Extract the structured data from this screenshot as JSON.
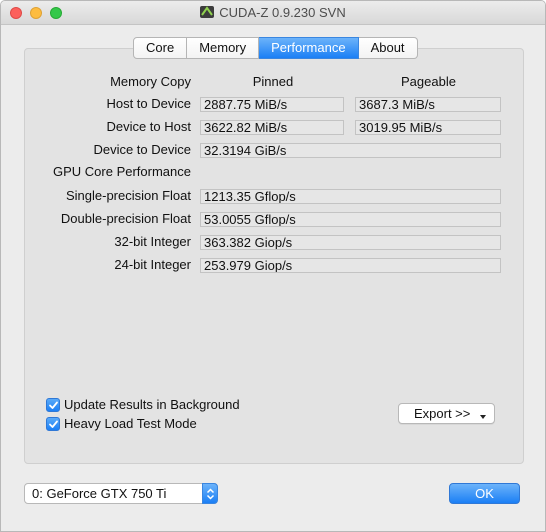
{
  "window": {
    "title": "CUDA-Z 0.9.230 SVN",
    "colors": {
      "accent": "#1b7ff5",
      "close": "#fc605c",
      "minimize": "#fdbc40",
      "maximize": "#34c84a"
    }
  },
  "tabs": [
    {
      "label": "Core"
    },
    {
      "label": "Memory"
    },
    {
      "label": "Performance",
      "active": true
    },
    {
      "label": "About"
    }
  ],
  "performance": {
    "memory_copy_label": "Memory Copy",
    "pinned_header": "Pinned",
    "pageable_header": "Pageable",
    "rows_memory": [
      {
        "label": "Host to Device",
        "pinned": "2887.75 MiB/s",
        "pageable": "3687.3 MiB/s"
      },
      {
        "label": "Device to Host",
        "pinned": "3622.82 MiB/s",
        "pageable": "3019.95 MiB/s"
      },
      {
        "label": "Device to Device",
        "pinned": "32.3194 GiB/s"
      }
    ],
    "gpu_core_label": "GPU Core Performance",
    "rows_core": [
      {
        "label": "Single-precision Float",
        "value": "1213.35 Gflop/s"
      },
      {
        "label": "Double-precision Float",
        "value": "53.0055 Gflop/s"
      },
      {
        "label": "32-bit Integer",
        "value": "363.382 Giop/s"
      },
      {
        "label": "24-bit Integer",
        "value": "253.979 Giop/s"
      }
    ]
  },
  "options": {
    "update_background": {
      "label": "Update Results in Background",
      "checked": true
    },
    "heavy_load": {
      "label": "Heavy Load Test Mode",
      "checked": true
    }
  },
  "export_button": {
    "label": "Export >>"
  },
  "device_select": {
    "value": "0: GeForce GTX 750 Ti"
  },
  "ok_button": {
    "label": "OK"
  }
}
